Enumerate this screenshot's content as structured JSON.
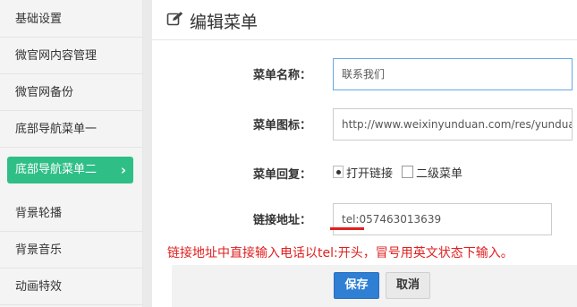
{
  "sidebar": {
    "items": [
      {
        "label": "基础设置"
      },
      {
        "label": "微官网内容管理"
      },
      {
        "label": "微官网备份"
      },
      {
        "label": "底部导航菜单一"
      },
      {
        "label": "底部导航菜单二",
        "active": true
      },
      {
        "label": "背景轮播"
      },
      {
        "label": "背景音乐"
      },
      {
        "label": "动画特效"
      }
    ],
    "active_chevron": "›"
  },
  "panel": {
    "title": "编辑菜单",
    "title_icon": "edit-icon"
  },
  "form": {
    "name_label": "菜单名称：",
    "name_value": "联系我们",
    "icon_label": "菜单图标：",
    "icon_value": "http://www.weixinyunduan.com/res/yunduan",
    "reply_label": "菜单回复：",
    "reply_options": [
      "打开链接",
      "二级菜单"
    ],
    "link_label": "链接地址：",
    "link_value": "tel:057463013639"
  },
  "hint": "链接地址中直接输入电话以tel:开头，冒号用英文状态下输入。",
  "buttons": {
    "save": "保存",
    "cancel": "取消"
  },
  "colors": {
    "accent_green": "#2fbf86",
    "primary_blue": "#2f7fd4",
    "hint_red": "#e02020"
  }
}
